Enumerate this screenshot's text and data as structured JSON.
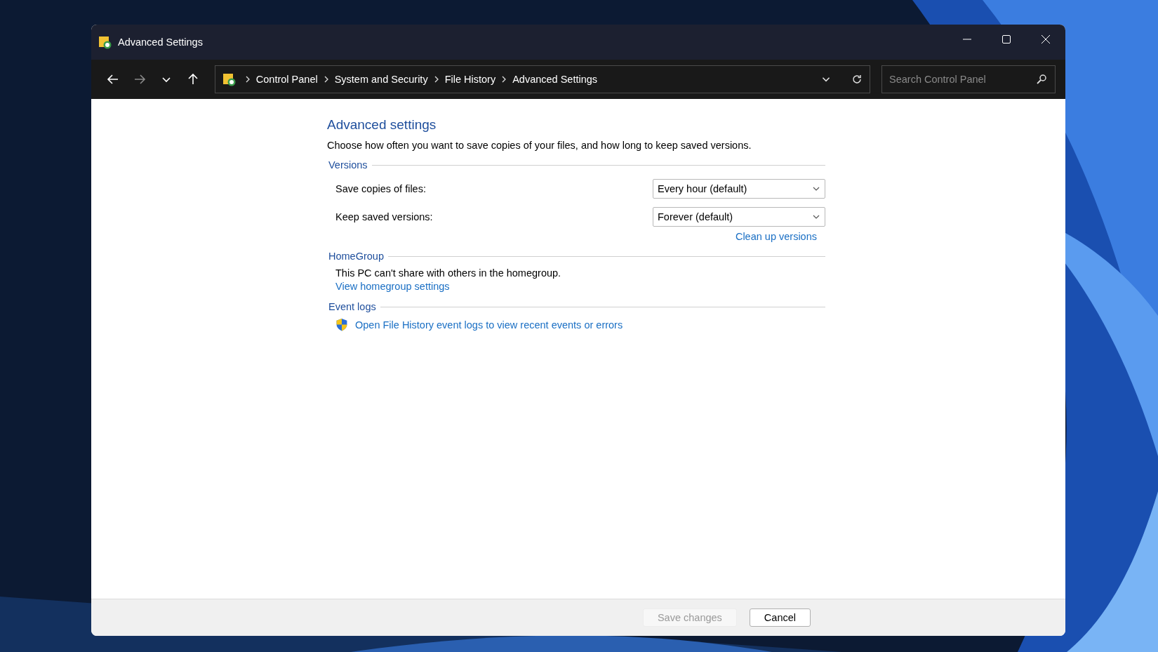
{
  "window": {
    "title": "Advanced Settings"
  },
  "nav": [
    {
      "kind": "back",
      "disabled": false
    },
    {
      "kind": "forward",
      "disabled": true
    },
    {
      "kind": "recent",
      "disabled": false
    },
    {
      "kind": "up",
      "disabled": false
    }
  ],
  "breadcrumbs": [
    "Control Panel",
    "System and Security",
    "File History",
    "Advanced Settings"
  ],
  "search": {
    "placeholder": "Search Control Panel"
  },
  "heading": "Advanced settings",
  "description": "Choose how often you want to save copies of your files, and how long to keep saved versions.",
  "sections": [
    {
      "title": "Versions",
      "rows": [
        {
          "label": "Save copies of files:",
          "value": "Every hour (default)"
        },
        {
          "label": "Keep saved versions:",
          "value": "Forever (default)"
        }
      ],
      "links": [
        {
          "label": "Clean up versions",
          "kind": "right"
        }
      ]
    },
    {
      "title": "HomeGroup",
      "text": "This PC can't share with others in the homegroup.",
      "links": [
        {
          "label": "View homegroup settings",
          "kind": "plain"
        }
      ]
    },
    {
      "title": "Event logs",
      "links": [
        {
          "label": "Open File History event logs to view recent events or errors",
          "kind": "shield"
        }
      ]
    }
  ],
  "buttons": [
    {
      "label": "Save changes",
      "disabled": true
    },
    {
      "label": "Cancel",
      "disabled": false
    }
  ]
}
